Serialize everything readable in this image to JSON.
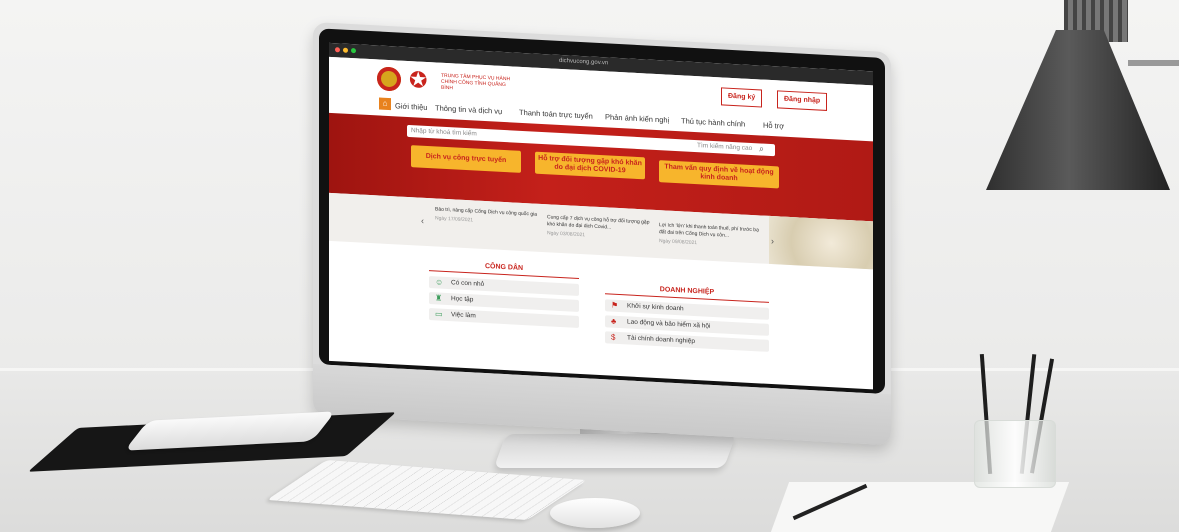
{
  "browser": {
    "url": "dichvucong.gov.vn"
  },
  "site": {
    "logo_text": "TRUNG TÂM PHỤC VỤ HÀNH CHÍNH CÔNG TỈNH QUẢNG BÌNH",
    "register_label": "Đăng ký",
    "login_label": "Đăng nhập",
    "nav": [
      "Giới thiệu",
      "Thông tin và dịch vụ",
      "Thanh toán trực tuyến",
      "Phản ánh kiến nghị",
      "Thủ tục hành chính",
      "Hỗ trợ"
    ],
    "search": {
      "placeholder": "Nhập từ khoá tìm kiếm",
      "advanced_label": "Tìm kiếm nâng cao"
    },
    "quick_buttons": [
      "Dịch vụ công trực tuyến",
      "Hỗ trợ đối tượng gặp khó khăn do đại dịch COVID-19",
      "Tham vấn quy định về hoạt động kinh doanh"
    ],
    "news": [
      {
        "title": "Bảo trì, nâng cấp Cổng Dịch vụ công quốc gia",
        "date": "Ngày 17/09/2021"
      },
      {
        "title": "Cung cấp 7 dịch vụ công hỗ trợ đối tượng gặp khó khăn do đại dịch Covid...",
        "date": "Ngày 03/08/2021"
      },
      {
        "title": "Lợi ích 'lớn' khi thanh toán thuế, phí trước bạ đất đai trên Cổng Dịch vụ côn...",
        "date": "Ngày 09/08/2021"
      }
    ],
    "citizen": {
      "title": "CÔNG DÂN",
      "items": [
        "Có con nhỏ",
        "Học tập",
        "Việc làm"
      ]
    },
    "business": {
      "title": "DOANH NGHIỆP",
      "items": [
        "Khởi sự kinh doanh",
        "Lao động và bảo hiểm xã hội",
        "Tài chính doanh nghiệp"
      ]
    }
  },
  "colors": {
    "brand_red": "#c8241d",
    "accent_yellow": "#f7b52c"
  }
}
